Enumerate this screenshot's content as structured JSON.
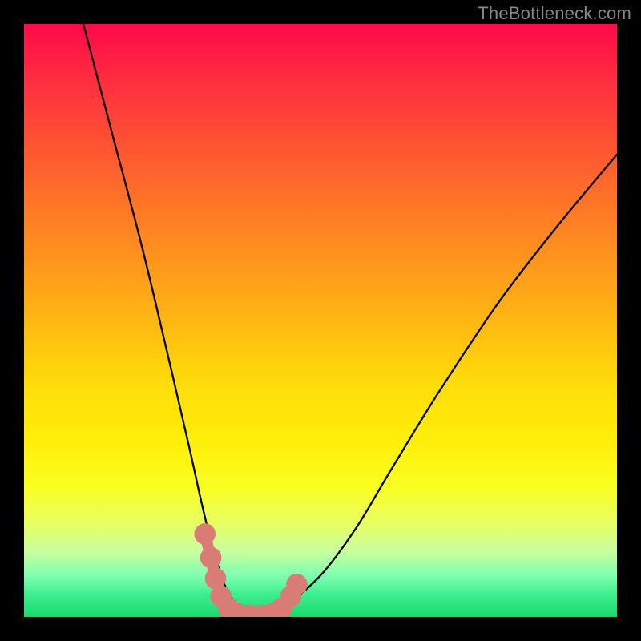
{
  "watermark": {
    "text": "TheBottleneck.com"
  },
  "colors": {
    "background": "#000000",
    "curve_stroke": "#000000",
    "marker_fill": "#d87c75",
    "marker_stroke": "#d87c75"
  },
  "chart_data": {
    "type": "line",
    "title": "",
    "xlabel": "",
    "ylabel": "",
    "xlim": [
      0,
      100
    ],
    "ylim": [
      0,
      100
    ],
    "grid": false,
    "series": [
      {
        "name": "bottleneck-curve",
        "x": [
          10,
          15,
          20,
          25,
          28,
          30,
          32,
          34,
          36,
          38,
          40,
          44,
          50,
          56,
          62,
          70,
          80,
          90,
          100
        ],
        "y": [
          100,
          81,
          62,
          41,
          28,
          19,
          11,
          5,
          2,
          1,
          1,
          2,
          7,
          15,
          25,
          38,
          53,
          66,
          78
        ]
      }
    ],
    "markers": [
      {
        "x": 30.5,
        "y": 14,
        "r": 1.8
      },
      {
        "x": 31.5,
        "y": 10,
        "r": 1.8
      },
      {
        "x": 32.3,
        "y": 6.5,
        "r": 1.8
      },
      {
        "x": 33.2,
        "y": 3.5,
        "r": 1.8
      },
      {
        "x": 34.5,
        "y": 1.5,
        "r": 1.8
      },
      {
        "x": 36.0,
        "y": 0.6,
        "r": 1.8
      },
      {
        "x": 38.0,
        "y": 0.3,
        "r": 1.8
      },
      {
        "x": 40.0,
        "y": 0.3,
        "r": 1.8
      },
      {
        "x": 42.0,
        "y": 0.6,
        "r": 1.8
      },
      {
        "x": 43.5,
        "y": 1.5,
        "r": 1.8
      },
      {
        "x": 45.0,
        "y": 3.5,
        "r": 1.8
      },
      {
        "x": 46.0,
        "y": 5.5,
        "r": 1.8
      }
    ],
    "connector": {
      "points": [
        [
          30.5,
          14
        ],
        [
          31.5,
          10
        ],
        [
          32.3,
          6.5
        ],
        [
          33.2,
          3.5
        ],
        [
          34.5,
          1.5
        ],
        [
          36.0,
          0.6
        ],
        [
          38.0,
          0.3
        ],
        [
          40.0,
          0.3
        ],
        [
          42.0,
          0.6
        ],
        [
          43.5,
          1.5
        ],
        [
          45.0,
          3.5
        ],
        [
          46.0,
          5.5
        ]
      ]
    }
  }
}
